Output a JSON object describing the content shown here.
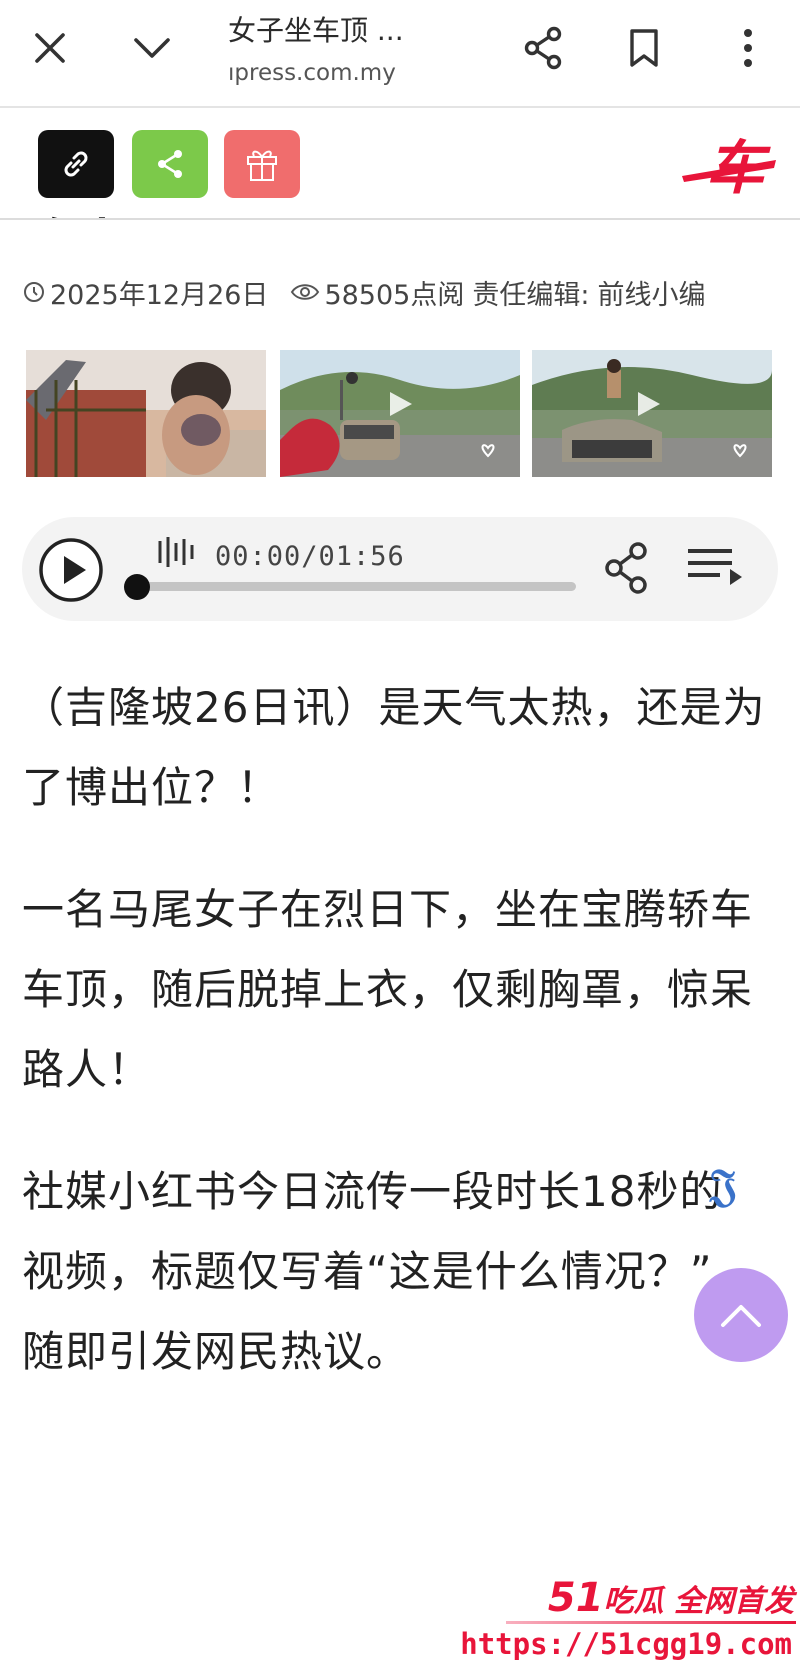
{
  "browser": {
    "tab_title": "女子坐车顶 ...",
    "url_display": "ıpress.com.my",
    "icons": [
      "close-icon",
      "chevron-down-icon",
      "share-icon",
      "bookmark-icon",
      "more-vert-icon"
    ]
  },
  "article_toolbar": {
    "buttons": [
      {
        "icon": "link-icon",
        "color": "#111111"
      },
      {
        "icon": "share-icon",
        "color": "#7cc94a"
      },
      {
        "icon": "gift-icon",
        "color": "#f06d6d"
      }
    ],
    "logo_text": "车",
    "title_peek": "路人"
  },
  "meta": {
    "date": "2025年12月26日",
    "views": "58505点阅",
    "editor_label": "责任编辑:",
    "editor_name": "前线小编"
  },
  "gallery": {
    "count": 3,
    "items": [
      "image-woman-on-car",
      "video-car-on-road",
      "video-woman-on-car-roof"
    ]
  },
  "audio": {
    "time": "00:00/01:56",
    "progress": 0
  },
  "article": {
    "paragraphs": [
      "（吉隆坡26日讯）是天气太热，还是为了博出位？！",
      "一名马尾女子在烈日下，坐在宝腾轿车车顶，随后脱掉上衣，仅剩胸罩，惊呆路人！",
      "社媒小红书今日流传一段时长18秒的视频，标题仅写着“这是什么情况？”，随即引发网民热议。"
    ]
  },
  "floating": {
    "corner_glyph": "𝔍",
    "scroll_top_color": "#bf9bf0"
  },
  "watermark": {
    "number": "51",
    "tagline": "吃瓜 全网首发",
    "url": "https://51cgg19.com"
  },
  "colors": {
    "accent_red": "#e8153a",
    "green": "#7cc94a",
    "purple": "#bf9bf0"
  }
}
